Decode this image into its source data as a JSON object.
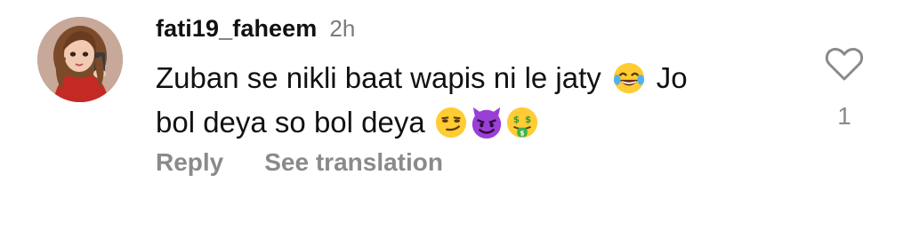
{
  "comment": {
    "username": "fati19_faheem",
    "time": "2h",
    "line1": "Zuban se nikli baat wapis ni le jaty",
    "line1_after": "Jo",
    "line2": "bol deya so bol deya",
    "emojis": [
      "tears-of-joy-emoji",
      "smirk-emoji",
      "smiling-devil-emoji",
      "money-mouth-emoji"
    ]
  },
  "actions": {
    "reply_label": "Reply",
    "translate_label": "See translation"
  },
  "likes": {
    "icon": "heart-outline-icon",
    "count": "1"
  },
  "colors": {
    "text": "#111111",
    "muted": "#8a8a8a",
    "time": "#7a7a7a"
  }
}
